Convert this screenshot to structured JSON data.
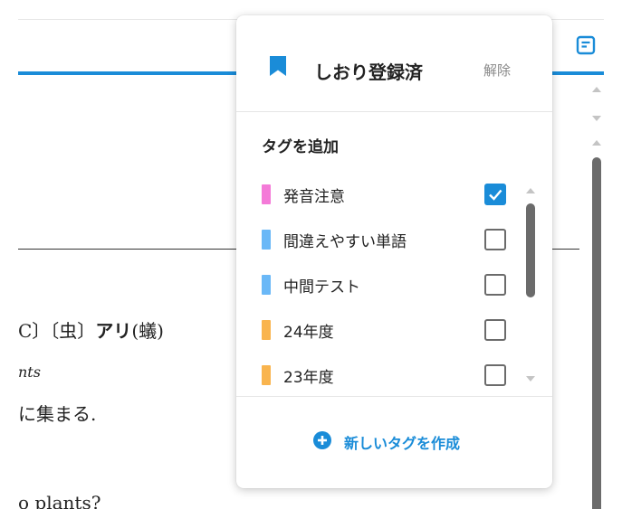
{
  "background": {
    "line1_prefix": "C〕〔虫〕",
    "line1_bold": "アリ",
    "line1_suffix": "(蟻)",
    "line2": "nts",
    "line3": "に集まる.",
    "line4": "o plants?"
  },
  "popup": {
    "header": {
      "title": "しおり登録済",
      "remove_label": "解除"
    },
    "section_title": "タグを追加",
    "tags": [
      {
        "label": "発音注意",
        "color": "#f47ad8",
        "checked": true
      },
      {
        "label": "間違えやすい単語",
        "color": "#6ab8f7",
        "checked": false
      },
      {
        "label": "中間テスト",
        "color": "#6ab8f7",
        "checked": false
      },
      {
        "label": "24年度",
        "color": "#f9b44e",
        "checked": false
      },
      {
        "label": "23年度",
        "color": "#f9b44e",
        "checked": false
      }
    ],
    "create_tag_label": "新しいタグを作成"
  },
  "colors": {
    "accent": "#1a8cd8"
  }
}
